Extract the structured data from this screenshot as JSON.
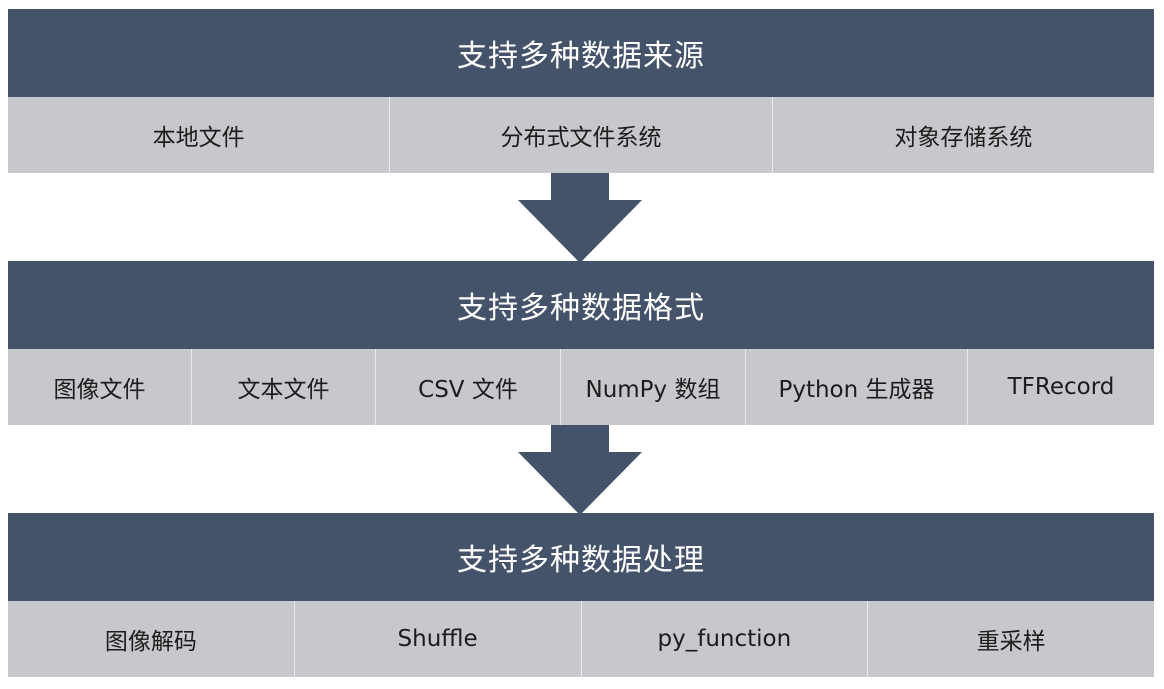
{
  "sections": [
    {
      "title": "支持多种数据来源",
      "items": [
        "本地文件",
        "分布式文件系统",
        "对象存储系统"
      ]
    },
    {
      "title": "支持多种数据格式",
      "items": [
        "图像文件",
        "文本文件",
        "CSV 文件",
        "NumPy 数组",
        "Python 生成器",
        "TFRecord"
      ]
    },
    {
      "title": "支持多种数据处理",
      "items": [
        "图像解码",
        "Shuffle",
        "py_function",
        "重采样"
      ]
    }
  ],
  "colors": {
    "header": "#44536a",
    "row": "#c6c8cc",
    "arrow": "#44536a"
  }
}
